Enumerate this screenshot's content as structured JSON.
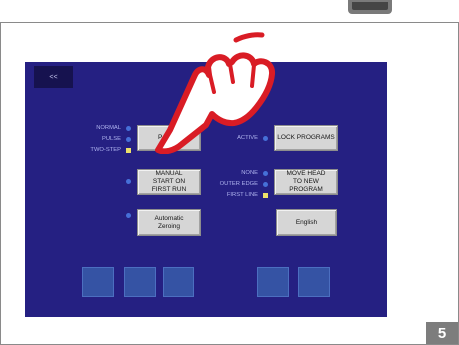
{
  "toolbar": {
    "back_label": "<<"
  },
  "mode_options": [
    "NORMAL",
    "PULSE",
    "TWO-STEP"
  ],
  "buttons": {
    "program_mode": "PROGRAM MODE",
    "program_mode_visible": "P",
    "program_mode_visible_tail": "DE",
    "manual_start": "MANUAL START ON FIRST RUN",
    "automatic_zeroing": "Automatic Zeroing",
    "lock_programs": "LOCK PROGRAMS",
    "move_head": "MOVE HEAD TO NEW PROGRAM",
    "language": "English"
  },
  "lock_status": "ACTIVE",
  "move_options": [
    "NONE",
    "OUTER EDGE",
    "FIRST LINE"
  ],
  "page_number": "5",
  "colors": {
    "screen_bg": "#252082",
    "selected_indicator": "#ece16a",
    "hand_outline": "#d91c25"
  },
  "icons": {
    "hand": "pointing-hand-icon"
  }
}
